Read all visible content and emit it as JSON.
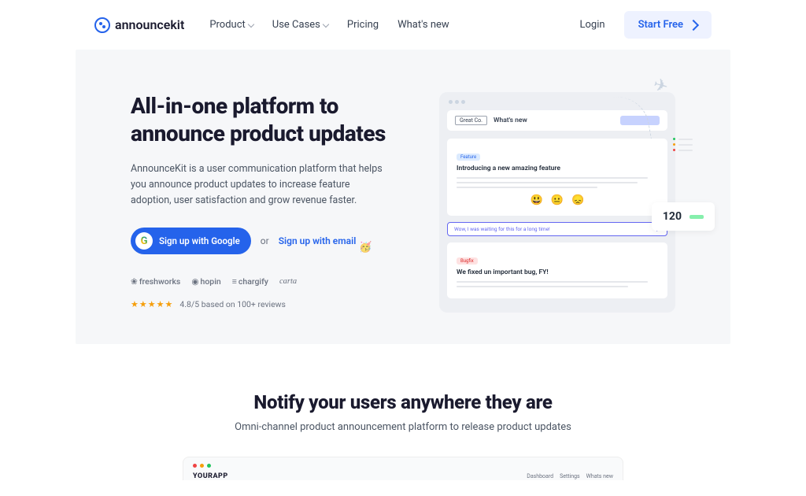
{
  "brand": "announcekit",
  "nav": {
    "items": [
      "Product",
      "Use Cases",
      "Pricing",
      "What's new"
    ],
    "login": "Login",
    "cta": "Start Free"
  },
  "hero": {
    "title_line1": "All-in-one platform to",
    "title_line2": "announce product updates",
    "description": "AnnounceKit is a user communication platform that helps you announce product updates to increase feature adoption, user satisfaction and grow revenue faster.",
    "google_btn": "Sign up with Google",
    "or": "or",
    "email_btn": "Sign up with email",
    "partners": [
      "freshworks",
      "hopin",
      "chargify",
      "carta"
    ],
    "rating_text": "4.8/5 based on 100+ reviews"
  },
  "mockup": {
    "brand_tag": "Great Co.",
    "header": "What's new",
    "card1_pill": "Feature",
    "card1_title": "Introducing a new amazing feature",
    "reply": "Wow, I was waiting for this for a long time!",
    "card2_pill": "Bugfix",
    "card2_title": "We fixed un important bug, FY!",
    "metric": "120",
    "emojis": [
      "😃",
      "😐",
      "😞"
    ]
  },
  "section2": {
    "title": "Notify your users anywhere they are",
    "subtitle": "Omni-channel product announcement platform to release product updates",
    "app_brand": "YOURAPP",
    "app_nav": [
      "Dashboard",
      "Settings",
      "Whats new"
    ]
  }
}
